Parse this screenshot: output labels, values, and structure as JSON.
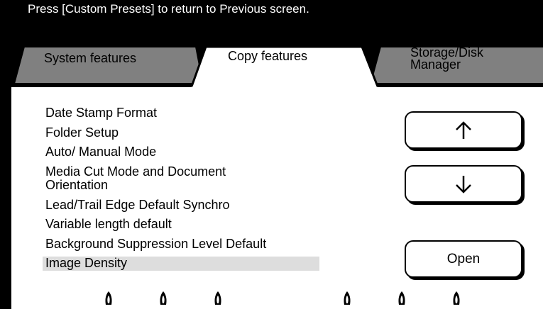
{
  "header": {
    "message": "Press [Custom Presets] to return to Previous screen."
  },
  "tabs": [
    {
      "label": "System features",
      "active": false
    },
    {
      "label": "Copy features",
      "active": true
    },
    {
      "label": "Storage/Disk Manager",
      "active": false
    }
  ],
  "list": {
    "items": [
      "Date Stamp Format",
      "Folder Setup",
      "Auto/ Manual Mode",
      "Media Cut Mode and Document Orientation",
      "Lead/Trail Edge Default Synchro",
      "Variable length default",
      "Background Suppression Level Default",
      "Image Density"
    ],
    "selected_index": 7
  },
  "buttons": {
    "scroll_up_icon": "arrow-up-icon",
    "scroll_down_icon": "arrow-down-icon",
    "open_label": "Open"
  },
  "footer": {
    "indicator_icon": "drop-icon",
    "indicator_count": 6
  }
}
